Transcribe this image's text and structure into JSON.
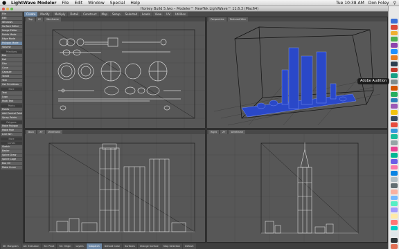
{
  "menubar": {
    "apple": "",
    "app": "LightWave Modeler",
    "items": [
      "File",
      "Edit",
      "Window",
      "Special",
      "Help"
    ],
    "clock": "Tue 10:38 AM",
    "user": "Don Foley"
  },
  "window": {
    "title": "Honley Build 5.lwo – Modeler™ NewTek LightWave™ 11.6.3 (Mac64)"
  },
  "tabs": [
    "Create",
    "Modify",
    "Multiply",
    "Detail",
    "Construct",
    "Map",
    "Setup",
    "Selected",
    "Loads",
    "View",
    "UV",
    "Utilities"
  ],
  "sidebar": {
    "groups": [
      {
        "title": "",
        "items": [
          "File",
          "Edit",
          "Windows",
          "Surface Editor",
          "Image Editor",
          "Points Mode",
          "Edge Mode",
          "Polygon Mode",
          "Volume"
        ]
      },
      {
        "title": "Primitives",
        "items": [
          "Box",
          "Ball",
          "Disc",
          "Cone",
          "Capsule",
          "Toroid",
          "Text",
          "Get Primitives"
        ]
      },
      {
        "title": "More",
        "items": [
          "Text",
          "Logo",
          "Multi Text"
        ]
      },
      {
        "title": "Points",
        "items": [
          "Points",
          "Add Control Point",
          "Spray Points"
        ]
      },
      {
        "title": "Polygons",
        "items": [
          "Make Polygon",
          "Make Pole",
          "Line Win"
        ]
      },
      {
        "title": "More",
        "items": []
      },
      {
        "title": "Curves",
        "items": [
          "Sketch",
          "Bezier",
          "Spline Draw",
          "Spline Cage",
          "Box UV",
          "Make Curve"
        ]
      }
    ]
  },
  "viewports": {
    "top_left": {
      "view": "Top",
      "mode": "Wireframe",
      "zoom": "XY"
    },
    "top_right": {
      "view": "Perspective",
      "mode": "Textured Wire",
      "zoom": ""
    },
    "bot_left": {
      "view": "Back",
      "mode": "Wireframe",
      "zoom": "XY"
    },
    "bot_right": {
      "view": "Right",
      "mode": "Wireframe",
      "zoom": "ZY"
    }
  },
  "status": [
    "SE: Mangram",
    "AC: Extrusion",
    "SC: Pivot",
    "SC: Origin",
    "Layers",
    "Subpatch",
    "Default Color",
    "Surfaces",
    "Change Surface",
    "Stop Selection",
    "Default"
  ],
  "tooltip": "Adobe Audition",
  "colors": {
    "accent": "#6d88a6",
    "selected_mesh": "#3355cc"
  }
}
